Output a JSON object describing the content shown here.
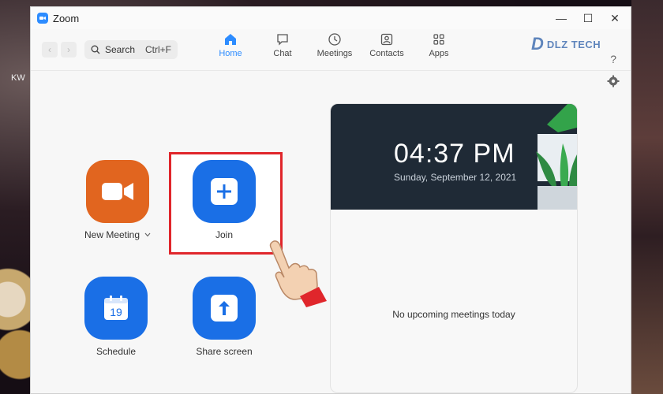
{
  "desktop": {
    "label": "KW"
  },
  "window": {
    "title": "Zoom",
    "controls": [
      "—",
      "☐",
      "✕"
    ]
  },
  "toolbar": {
    "search_label": "Search",
    "search_shortcut": "Ctrl+F",
    "tabs": [
      {
        "label": "Home",
        "icon": "home-icon",
        "active": true
      },
      {
        "label": "Chat",
        "icon": "chat-icon",
        "active": false
      },
      {
        "label": "Meetings",
        "icon": "clock-icon",
        "active": false
      },
      {
        "label": "Contacts",
        "icon": "contacts-icon",
        "active": false
      },
      {
        "label": "Apps",
        "icon": "apps-icon",
        "active": false
      }
    ],
    "brand_logo_text": "DLZ TECH",
    "help_symbol": "?"
  },
  "actions": [
    {
      "label": "New Meeting",
      "icon": "video-camera-icon",
      "color": "#e1651f",
      "has_dropdown": true
    },
    {
      "label": "Join",
      "icon": "plus-icon",
      "color": "#1a6fe6",
      "highlighted": true
    },
    {
      "label": "Schedule",
      "icon": "calendar-icon",
      "color": "#1a6fe6",
      "day": "19"
    },
    {
      "label": "Share screen",
      "icon": "share-arrow-icon",
      "color": "#1a6fe6"
    }
  ],
  "calendar_card": {
    "time": "04:37 PM",
    "date": "Sunday, September 12, 2021",
    "empty_message": "No upcoming meetings today"
  },
  "colors": {
    "accent": "#2d8cff",
    "highlight": "#e0262b",
    "header_bg": "#1f2a36"
  }
}
